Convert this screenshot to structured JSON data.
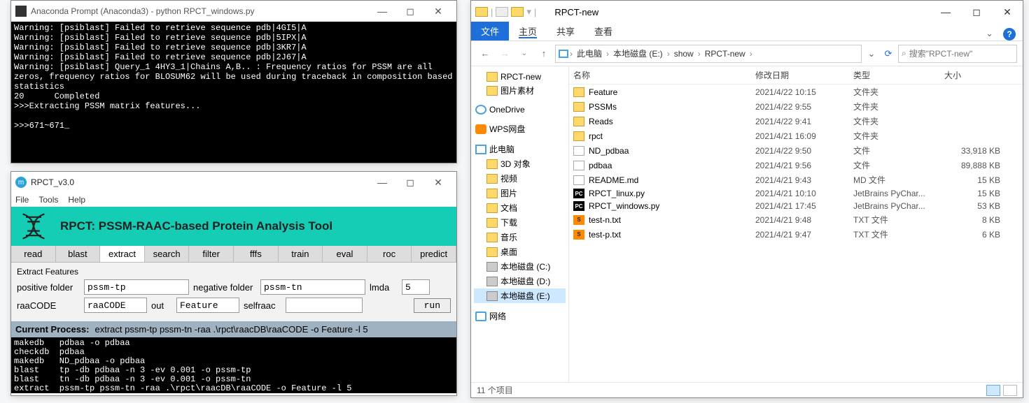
{
  "cmd": {
    "title": "Anaconda Prompt (Anaconda3) - python  RPCT_windows.py",
    "lines": [
      "Warning: [psiblast] Failed to retrieve sequence pdb|4GI5|A",
      "Warning: [psiblast] Failed to retrieve sequence pdb|5IPX|A",
      "Warning: [psiblast] Failed to retrieve sequence pdb|3KR7|A",
      "Warning: [psiblast] Failed to retrieve sequence pdb|2J67|A",
      "Warning: [psiblast] Query_1 4HY3_1|Chains A,B.. : Frequency ratios for PSSM are all zeros, frequency ratios for BLOSUM62 will be used during traceback in composition based statistics",
      "20      Completed",
      ">>>Extracting PSSM matrix features...",
      "",
      ">>>671~671_"
    ]
  },
  "app": {
    "title": "RPCT_v3.0",
    "menus": [
      "File",
      "Tools",
      "Help"
    ],
    "banner": "RPCT: PSSM-RAAC-based Protein Analysis Tool",
    "tabs": [
      "read",
      "blast",
      "extract",
      "search",
      "filter",
      "fffs",
      "train",
      "eval",
      "roc",
      "predict"
    ],
    "active_tab": "extract",
    "panel_title": "Extract Features",
    "fields": {
      "positive_folder_label": "positive folder",
      "positive_folder": "pssm-tp",
      "negative_folder_label": "negative folder",
      "negative_folder": "pssm-tn",
      "lmda_label": "lmda",
      "lmda": "5",
      "raacode_label": "raaCODE",
      "raacode": "raaCODE",
      "out_label": "out",
      "out": "Feature",
      "selfraac_label": "selfraac",
      "selfraac": ""
    },
    "run": "run",
    "process_label": "Current Process:",
    "process_text": "extract   pssm-tp pssm-tn -raa .\\rpct\\raacDB\\raaCODE -o Feature -l 5",
    "log": [
      "makedb   pdbaa -o pdbaa",
      "checkdb  pdbaa",
      "makedb   ND_pdbaa -o pdbaa",
      "blast    tp -db pdbaa -n 3 -ev 0.001 -o pssm-tp",
      "blast    tn -db pdbaa -n 3 -ev 0.001 -o pssm-tn",
      "extract  pssm-tp pssm-tn -raa .\\rpct\\raacDB\\raaCODE -o Feature -l 5"
    ]
  },
  "explorer": {
    "title": "RPCT-new",
    "ribbon": {
      "file": "文件",
      "home": "主页",
      "share": "共享",
      "view": "查看"
    },
    "breadcrumb": [
      "此电脑",
      "本地磁盘 (E:)",
      "show",
      "RPCT-new"
    ],
    "search_placeholder": "搜索\"RPCT-new\"",
    "tree": [
      {
        "label": "RPCT-new",
        "icon": "folder",
        "indent": 1
      },
      {
        "label": "图片素材",
        "icon": "folder",
        "indent": 1
      },
      {
        "label": "OneDrive",
        "icon": "cloud",
        "indent": 0
      },
      {
        "label": "WPS网盘",
        "icon": "orange",
        "indent": 0
      },
      {
        "label": "此电脑",
        "icon": "pc",
        "indent": 0
      },
      {
        "label": "3D 对象",
        "icon": "folder",
        "indent": 1
      },
      {
        "label": "视频",
        "icon": "folder",
        "indent": 1
      },
      {
        "label": "图片",
        "icon": "folder",
        "indent": 1
      },
      {
        "label": "文档",
        "icon": "folder",
        "indent": 1
      },
      {
        "label": "下载",
        "icon": "folder",
        "indent": 1
      },
      {
        "label": "音乐",
        "icon": "folder",
        "indent": 1
      },
      {
        "label": "桌面",
        "icon": "folder",
        "indent": 1
      },
      {
        "label": "本地磁盘 (C:)",
        "icon": "drive",
        "indent": 1
      },
      {
        "label": "本地磁盘 (D:)",
        "icon": "drive",
        "indent": 1
      },
      {
        "label": "本地磁盘 (E:)",
        "icon": "drive",
        "indent": 1,
        "selected": true
      },
      {
        "label": "网络",
        "icon": "net",
        "indent": 0
      }
    ],
    "columns": {
      "name": "名称",
      "date": "修改日期",
      "type": "类型",
      "size": "大小"
    },
    "files": [
      {
        "name": "Feature",
        "date": "2021/4/22 10:15",
        "type": "文件夹",
        "size": "",
        "icon": "folder"
      },
      {
        "name": "PSSMs",
        "date": "2021/4/22 9:55",
        "type": "文件夹",
        "size": "",
        "icon": "folder"
      },
      {
        "name": "Reads",
        "date": "2021/4/22 9:41",
        "type": "文件夹",
        "size": "",
        "icon": "folder"
      },
      {
        "name": "rpct",
        "date": "2021/4/21 16:09",
        "type": "文件夹",
        "size": "",
        "icon": "folder"
      },
      {
        "name": "ND_pdbaa",
        "date": "2021/4/22 9:50",
        "type": "文件",
        "size": "33,918 KB",
        "icon": "file"
      },
      {
        "name": "pdbaa",
        "date": "2021/4/21 9:56",
        "type": "文件",
        "size": "89,888 KB",
        "icon": "file"
      },
      {
        "name": "README.md",
        "date": "2021/4/21 9:43",
        "type": "MD 文件",
        "size": "15 KB",
        "icon": "file"
      },
      {
        "name": "RPCT_linux.py",
        "date": "2021/4/21 10:10",
        "type": "JetBrains PyChar...",
        "size": "15 KB",
        "icon": "pc"
      },
      {
        "name": "RPCT_windows.py",
        "date": "2021/4/21 17:45",
        "type": "JetBrains PyChar...",
        "size": "53 KB",
        "icon": "pc"
      },
      {
        "name": "test-n.txt",
        "date": "2021/4/21 9:48",
        "type": "TXT 文件",
        "size": "8 KB",
        "icon": "sub"
      },
      {
        "name": "test-p.txt",
        "date": "2021/4/21 9:47",
        "type": "TXT 文件",
        "size": "6 KB",
        "icon": "sub"
      }
    ],
    "status": "11 个项目"
  }
}
